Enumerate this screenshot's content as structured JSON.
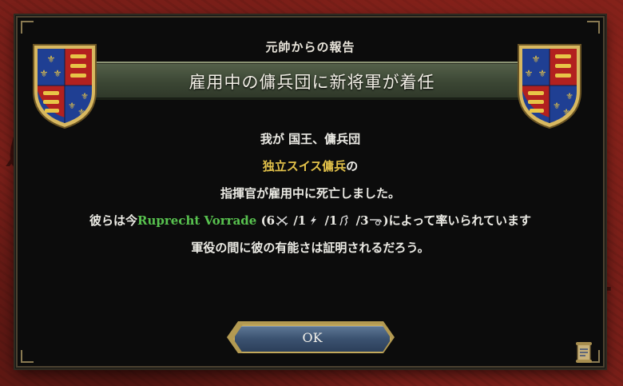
{
  "dialog": {
    "subtitle": "元帥からの報告",
    "title": "雇用中の傭兵団に新将軍が着任",
    "lines": {
      "l1": "我が 国王、傭兵団",
      "l2_unit": "独立スイス傭兵",
      "l2_suffix": "の",
      "l3": "指揮官が雇用中に死亡しました。",
      "l4_prefix": "彼らは今",
      "l4_general": "Ruprecht Vorrade",
      "l4_open": " (",
      "l4_fire": "6",
      "l4_shock": " /1",
      "l4_maneuver": " /1",
      "l4_siege": " /3",
      "l4_close": ")によって率いられています",
      "l5": "軍役の間に彼の有能さは証明されるだろう。"
    },
    "ok_label": "OK"
  },
  "icons": {
    "fire": "crossed-swords-icon",
    "shock": "lightning-icon",
    "maneuver": "horse-icon",
    "siege": "cannon-icon",
    "coat_of_arms": "english-royal-arms",
    "ledger": "scroll-icon"
  },
  "colors": {
    "dialog_bg": "#0c0c0c",
    "banner": "#3b4634",
    "unit_name": "#e3c24a",
    "general_name": "#58c24f",
    "button": "#3b5270",
    "button_border": "#c2a85b"
  }
}
